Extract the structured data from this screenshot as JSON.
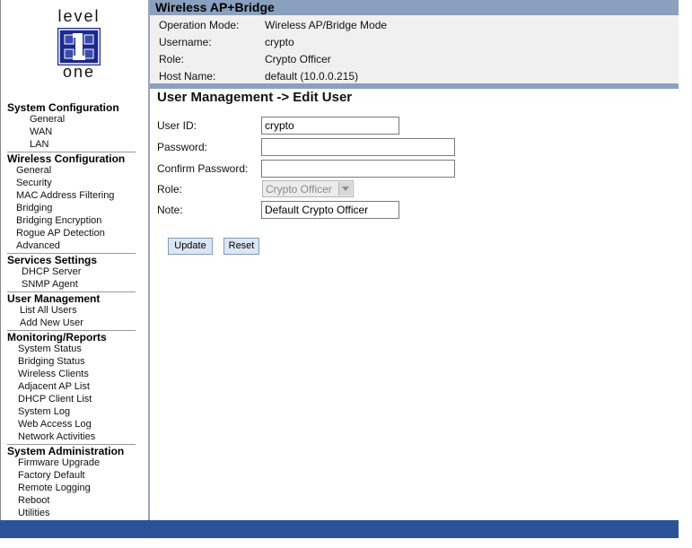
{
  "app": {
    "title": "Wireless AP+Bridge"
  },
  "logo": {
    "top_text": "level",
    "bottom_text": "one",
    "mark": "1",
    "colors": {
      "blue": "#1a2a8a",
      "white": "#ffffff"
    }
  },
  "info": {
    "rows": [
      {
        "label": "Operation Mode:",
        "value": "Wireless AP/Bridge Mode"
      },
      {
        "label": "Username:",
        "value": "crypto"
      },
      {
        "label": "Role:",
        "value": "Crypto Officer"
      },
      {
        "label": "Host Name:",
        "value": "default (10.0.0.215)"
      }
    ]
  },
  "sidebar": {
    "sections": [
      {
        "title": "System Configuration",
        "items": [
          "General",
          "WAN",
          "LAN"
        ]
      },
      {
        "title": "Wireless Configuration",
        "items": [
          "General",
          "Security",
          "MAC Address Filtering",
          "Bridging",
          "Bridging Encryption",
          "Rogue AP Detection",
          "Advanced"
        ]
      },
      {
        "title": "Services Settings",
        "items": [
          "DHCP Server",
          "SNMP Agent"
        ]
      },
      {
        "title": "User Management",
        "items": [
          "List All Users",
          "Add New User"
        ]
      },
      {
        "title": "Monitoring/Reports",
        "items": [
          "System Status",
          "Bridging Status",
          "Wireless Clients",
          "Adjacent AP List",
          "DHCP Client List",
          "System Log",
          "Web Access Log",
          "Network Activities"
        ]
      },
      {
        "title": "System Administration",
        "items": [
          "Firmware Upgrade",
          "Factory Default",
          "Remote Logging",
          "Reboot",
          "Utilities"
        ]
      }
    ]
  },
  "main": {
    "page_title": "User Management -> Edit User",
    "form": {
      "user_id_label": "User ID:",
      "user_id_value": "crypto",
      "password_label": "Password:",
      "password_value": "",
      "confirm_label": "Confirm Password:",
      "confirm_value": "",
      "role_label": "Role:",
      "role_value": "Crypto Officer",
      "note_label": "Note:",
      "note_value": "Default Crypto Officer"
    },
    "buttons": {
      "update": "Update",
      "reset": "Reset"
    }
  },
  "colors": {
    "header_bar": "#8aa0bf",
    "info_bg": "#f0f0f0",
    "footer": "#2a5298",
    "button_bg": "#dce6f2"
  }
}
